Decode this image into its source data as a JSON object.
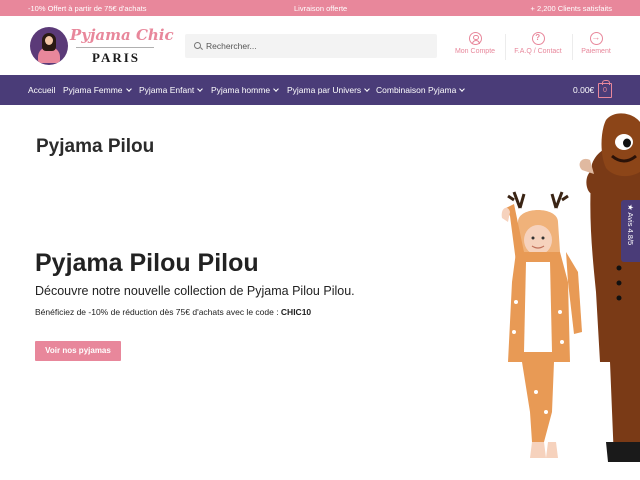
{
  "topbar": {
    "left": "-10% Offert à partir de 75€ d'achats",
    "center": "Livraison offerte",
    "right": "+ 2,200 Clients satisfaits"
  },
  "header": {
    "logo_title": "Pyjama Chic",
    "logo_subtitle": "PARIS",
    "search_placeholder": "Rechercher...",
    "links": {
      "account": "Mon Compte",
      "faq": "F.A.Q / Contact",
      "payment": "Paiement"
    }
  },
  "nav": {
    "items": [
      {
        "label": "Accueil",
        "has_dropdown": false
      },
      {
        "label": "Pyjama Femme",
        "has_dropdown": true
      },
      {
        "label": "Pyjama Enfant",
        "has_dropdown": true
      },
      {
        "label": "Pyjama homme",
        "has_dropdown": true
      },
      {
        "label": "Pyjama par Univers",
        "has_dropdown": true
      },
      {
        "label": "Combinaison Pyjama",
        "has_dropdown": true
      }
    ],
    "cart_total": "0.00€",
    "cart_count": "0"
  },
  "page": {
    "title": "Pyjama Pilou"
  },
  "hero": {
    "title": "Pyjama Pilou Pilou",
    "subtitle": "Découvre notre nouvelle collection de Pyjama Pilou Pilou.",
    "promo_text": "Bénéficiez de -10% de réduction dès 75€ d'achats avec le code : ",
    "promo_code": "CHIC10",
    "cta_label": "Voir nos pyjamas"
  },
  "reviews_tab": {
    "star": "★",
    "label": "Avis 4.8/5"
  },
  "colors": {
    "accent_pink": "#e8879b",
    "nav_purple": "#4a3c78",
    "text_dark": "#222222"
  }
}
